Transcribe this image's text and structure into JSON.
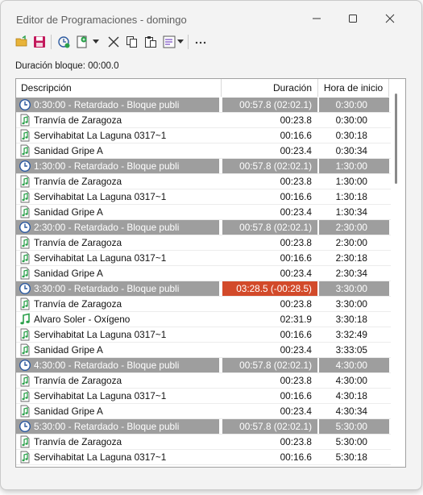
{
  "window": {
    "title": "Editor de Programaciones - domingo"
  },
  "block_duration_label": "Duración bloque: 00:00.0",
  "columns": {
    "description": "Descripción",
    "duration": "Duración",
    "start": "Hora de inicio"
  },
  "colors": {
    "block_bg": "#9e9e9e",
    "over_bg": "#d24a2a",
    "music_icon": "#2aa04a",
    "clock_icon": "#2c5aa0"
  },
  "rows": [
    {
      "type": "block",
      "icon": "clock-icon",
      "desc": "0:30:00 - Retardado - Bloque publi",
      "dur": "00:57.8 (02:02.1)",
      "start": "0:30:00"
    },
    {
      "type": "item",
      "icon": "music-file-icon",
      "desc": "Tranvía de Zaragoza",
      "dur": "00:23.8",
      "start": "0:30:00"
    },
    {
      "type": "item",
      "icon": "music-file-icon",
      "desc": "Servihabitat La Laguna 0317~1",
      "dur": "00:16.6",
      "start": "0:30:18"
    },
    {
      "type": "item",
      "icon": "music-file-icon",
      "desc": "Sanidad Gripe A",
      "dur": "00:23.4",
      "start": "0:30:34"
    },
    {
      "type": "block",
      "icon": "clock-icon",
      "desc": "1:30:00 - Retardado - Bloque publi",
      "dur": "00:57.8 (02:02.1)",
      "start": "1:30:00"
    },
    {
      "type": "item",
      "icon": "music-file-icon",
      "desc": "Tranvía de Zaragoza",
      "dur": "00:23.8",
      "start": "1:30:00"
    },
    {
      "type": "item",
      "icon": "music-file-icon",
      "desc": "Servihabitat La Laguna 0317~1",
      "dur": "00:16.6",
      "start": "1:30:18"
    },
    {
      "type": "item",
      "icon": "music-file-icon",
      "desc": "Sanidad Gripe A",
      "dur": "00:23.4",
      "start": "1:30:34"
    },
    {
      "type": "block",
      "icon": "clock-icon",
      "desc": "2:30:00 - Retardado - Bloque publi",
      "dur": "00:57.8 (02:02.1)",
      "start": "2:30:00"
    },
    {
      "type": "item",
      "icon": "music-file-icon",
      "desc": "Tranvía de Zaragoza",
      "dur": "00:23.8",
      "start": "2:30:00"
    },
    {
      "type": "item",
      "icon": "music-file-icon",
      "desc": "Servihabitat La Laguna 0317~1",
      "dur": "00:16.6",
      "start": "2:30:18"
    },
    {
      "type": "item",
      "icon": "music-file-icon",
      "desc": "Sanidad Gripe A",
      "dur": "00:23.4",
      "start": "2:30:34"
    },
    {
      "type": "block",
      "icon": "clock-icon",
      "desc": "3:30:00 - Retardado - Bloque publi",
      "dur": "03:28.5 (-00:28.5)",
      "start": "3:30:00",
      "over": true
    },
    {
      "type": "item",
      "icon": "music-file-icon",
      "desc": "Tranvía de Zaragoza",
      "dur": "00:23.8",
      "start": "3:30:00"
    },
    {
      "type": "item",
      "icon": "music-note-icon",
      "desc": "Alvaro Soler - Oxígeno",
      "dur": "02:31.9",
      "start": "3:30:18"
    },
    {
      "type": "item",
      "icon": "music-file-icon",
      "desc": "Servihabitat La Laguna 0317~1",
      "dur": "00:16.6",
      "start": "3:32:49"
    },
    {
      "type": "item",
      "icon": "music-file-icon",
      "desc": "Sanidad Gripe A",
      "dur": "00:23.4",
      "start": "3:33:05"
    },
    {
      "type": "block",
      "icon": "clock-icon",
      "desc": "4:30:00 - Retardado - Bloque publi",
      "dur": "00:57.8 (02:02.1)",
      "start": "4:30:00"
    },
    {
      "type": "item",
      "icon": "music-file-icon",
      "desc": "Tranvía de Zaragoza",
      "dur": "00:23.8",
      "start": "4:30:00"
    },
    {
      "type": "item",
      "icon": "music-file-icon",
      "desc": "Servihabitat La Laguna 0317~1",
      "dur": "00:16.6",
      "start": "4:30:18"
    },
    {
      "type": "item",
      "icon": "music-file-icon",
      "desc": "Sanidad Gripe A",
      "dur": "00:23.4",
      "start": "4:30:34"
    },
    {
      "type": "block",
      "icon": "clock-icon",
      "desc": "5:30:00 - Retardado - Bloque publi",
      "dur": "00:57.8 (02:02.1)",
      "start": "5:30:00"
    },
    {
      "type": "item",
      "icon": "music-file-icon",
      "desc": "Tranvía de Zaragoza",
      "dur": "00:23.8",
      "start": "5:30:00"
    },
    {
      "type": "item",
      "icon": "music-file-icon",
      "desc": "Servihabitat La Laguna 0317~1",
      "dur": "00:16.6",
      "start": "5:30:18"
    }
  ]
}
